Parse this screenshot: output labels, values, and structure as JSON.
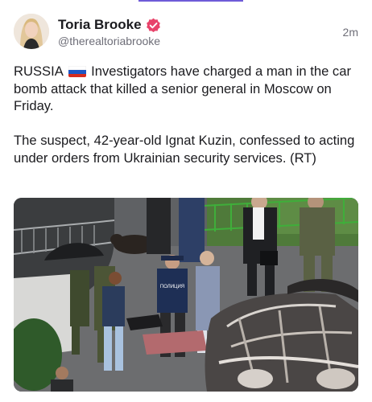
{
  "post": {
    "author_name": "Toria Brooke",
    "handle": "@therealtoriabrooke",
    "timestamp": "2m",
    "text_line1_prefix": "RUSSIA",
    "text_line1_flag": "🇷🇺",
    "text_para1_rest": "Investigators have charged a man in the car bomb attack that killed a senior general in Moscow on Friday.",
    "text_para2": "The suspect, 42-year-old Ignat Kuzin, confessed to acting under orders from Ukrainian security services. (RT)"
  },
  "media": {
    "police_jacket_text": "ПОЛИЦИЯ"
  },
  "colors": {
    "accent": "#6e5bd8",
    "verified_badge": "#e8436a",
    "text_primary": "#1b1b1f",
    "text_secondary": "#6e6e78"
  },
  "icons": {
    "verified": "verified-badge-icon",
    "flag": "russia-flag-icon"
  }
}
